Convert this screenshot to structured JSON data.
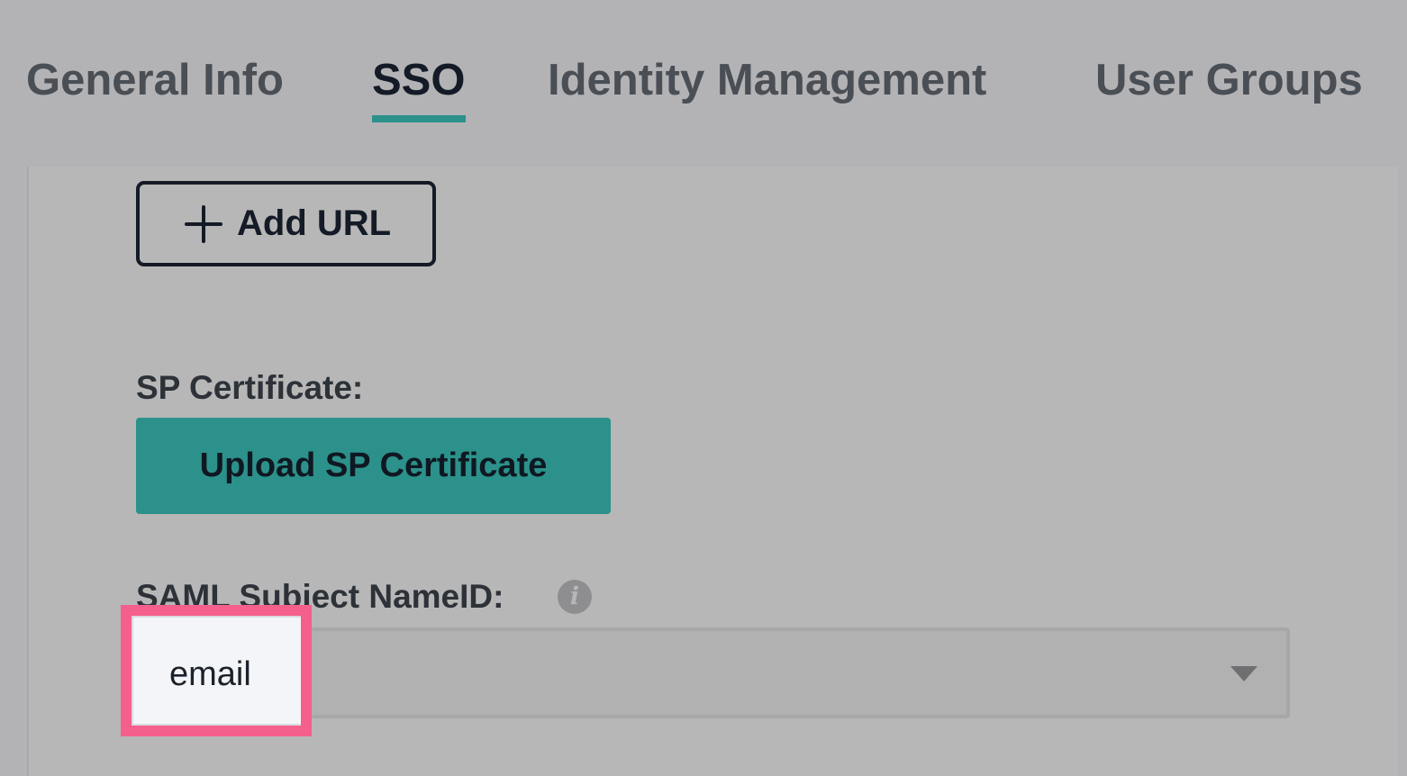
{
  "tabs": [
    {
      "label": "General Info",
      "active": false
    },
    {
      "label": "SSO",
      "active": true
    },
    {
      "label": "Identity Management",
      "active": false
    },
    {
      "label": "User Groups",
      "active": false
    }
  ],
  "add_url": {
    "label": "Add URL",
    "icon": "plus-icon"
  },
  "sp_certificate": {
    "label": "SP Certificate:",
    "upload_label": "Upload SP Certificate"
  },
  "saml_nameid": {
    "label": "SAML Subject NameID:",
    "info_icon": "i",
    "selected_value": "email"
  },
  "colors": {
    "accent": "#2b918a",
    "highlight": "#f45f8c",
    "text_dark": "#141b26",
    "background": "#b3b3b6"
  }
}
